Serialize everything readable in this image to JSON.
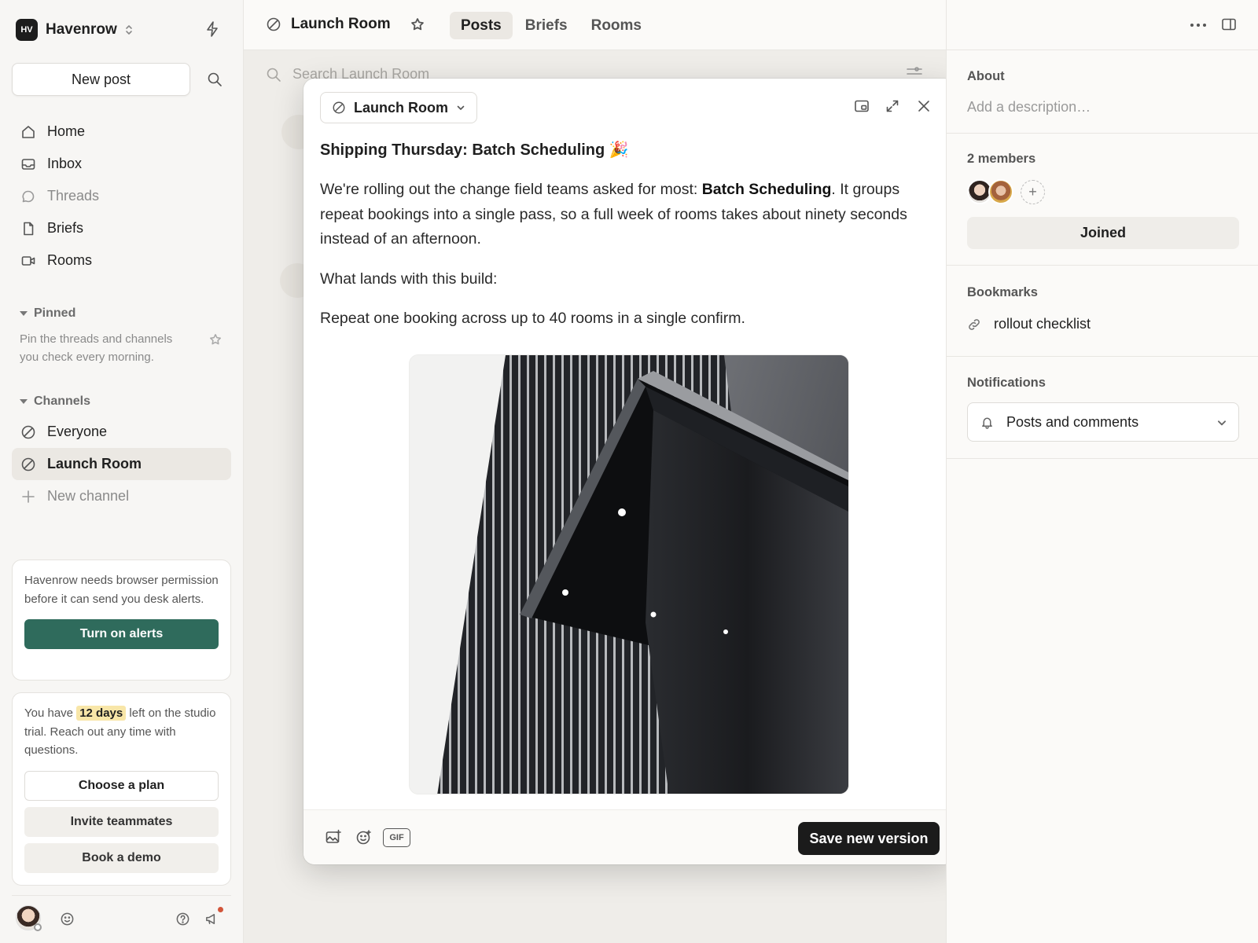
{
  "workspace": {
    "initials": "HV",
    "name": "Havenrow"
  },
  "sidebar": {
    "new_post": "New post",
    "nav": [
      {
        "label": "Home",
        "icon": "home-icon"
      },
      {
        "label": "Inbox",
        "icon": "inbox-icon"
      },
      {
        "label": "Threads",
        "icon": "threads-icon"
      },
      {
        "label": "Briefs",
        "icon": "document-icon"
      },
      {
        "label": "Rooms",
        "icon": "video-icon"
      }
    ],
    "pinned": {
      "title": "Pinned",
      "hint": "Pin the threads and channels you check every morning."
    },
    "channels": {
      "title": "Channels",
      "items": [
        {
          "label": "Everyone"
        },
        {
          "label": "Launch Room"
        }
      ],
      "new_channel": "New channel"
    },
    "alerts_card": {
      "text": "Havenrow needs browser permission before it can send you desk alerts.",
      "button": "Turn on alerts"
    },
    "trial_card": {
      "prefix": "You have",
      "days": "12 days",
      "suffix": "left on the studio trial. Reach out any time with questions.",
      "choose_plan": "Choose a plan",
      "invite": "Invite teammates",
      "demo": "Book a demo"
    }
  },
  "topbar": {
    "channel": "Launch Room",
    "tabs": [
      "Posts",
      "Briefs",
      "Rooms"
    ]
  },
  "search": {
    "placeholder": "Search Launch Room"
  },
  "composer": {
    "channel": "Launch Room",
    "title": "Shipping Thursday: Batch Scheduling 🎉",
    "p1_before": "We're rolling out the change field teams asked for most: ",
    "p1_bold": "Batch Scheduling",
    "p1_after": ". It groups repeat bookings into a single pass, so a full week of rooms takes about ninety seconds instead of an afternoon.",
    "p2": "What lands with this build:",
    "p3": "Repeat one booking across up to 40 rooms in a single confirm.",
    "gif": "GIF",
    "save": "Save new version"
  },
  "right_panel": {
    "about": {
      "label": "About",
      "placeholder": "Add a description…"
    },
    "members": {
      "label": "2 members",
      "add": "+",
      "joined": "Joined"
    },
    "bookmarks": {
      "label": "Bookmarks",
      "item": "rollout checklist"
    },
    "notifications": {
      "label": "Notifications",
      "value": "Posts and comments"
    }
  },
  "colors": {
    "accent_green": "#2f6b5c",
    "highlight": "#f8e6a8",
    "primary_dark": "#1b1b1b",
    "notification_dot": "#d2553a"
  }
}
